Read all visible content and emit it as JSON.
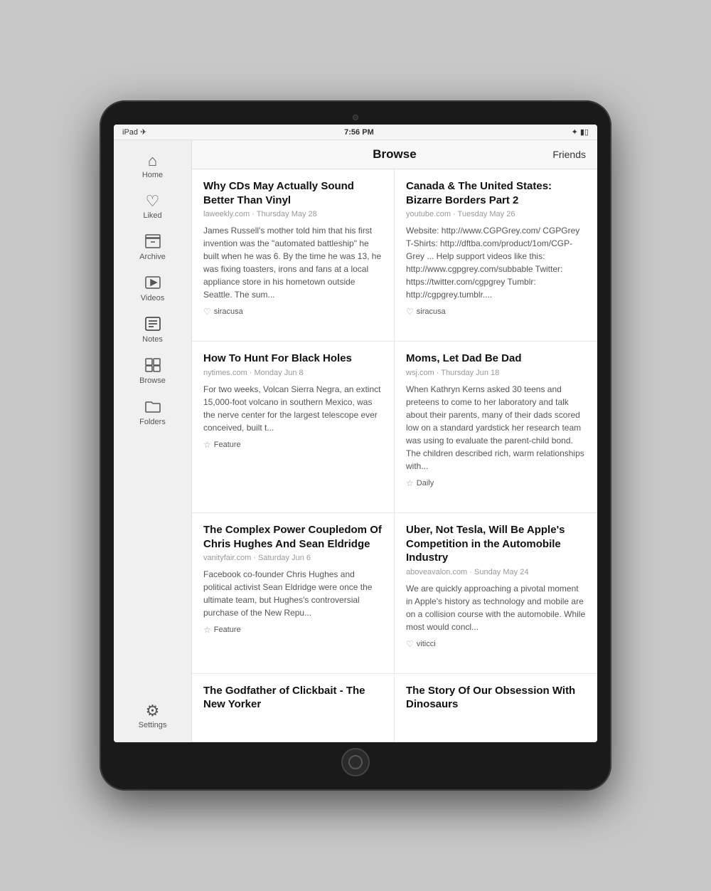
{
  "device": {
    "status_bar": {
      "left": "iPad ✈",
      "center": "7:56 PM",
      "right": "🔵 ■□"
    }
  },
  "sidebar": {
    "items": [
      {
        "id": "home",
        "label": "Home",
        "icon": "⌂"
      },
      {
        "id": "liked",
        "label": "Liked",
        "icon": "♡"
      },
      {
        "id": "archive",
        "label": "Archive",
        "icon": "▣"
      },
      {
        "id": "videos",
        "label": "Videos",
        "icon": "▷"
      },
      {
        "id": "notes",
        "label": "Notes",
        "icon": "≡"
      },
      {
        "id": "browse",
        "label": "Browse",
        "icon": "⊞"
      },
      {
        "id": "folders",
        "label": "Folders",
        "icon": "⬜"
      },
      {
        "id": "settings",
        "label": "Settings",
        "icon": "⚙"
      }
    ]
  },
  "top_bar": {
    "title": "Browse",
    "action": "Friends"
  },
  "articles": [
    {
      "id": 1,
      "title": "Why CDs May Actually Sound Better Than Vinyl",
      "meta": "laweekly.com · Thursday May 28",
      "excerpt": "James Russell's mother told him that his first invention was the \"automated battleship\" he built when he was 6. By the time he was 13, he was fixing toasters, irons and fans at a local appliance store in his hometown outside Seattle. The sum...",
      "footer_icon": "heart",
      "footer_tag": "siracusa"
    },
    {
      "id": 2,
      "title": "Canada & The United States: Bizarre Borders Part 2",
      "meta": "youtube.com · Tuesday May 26",
      "excerpt": "Website: http://www.CGPGrey.com/ CGPGrey T-Shirts: http://dftba.com/product/1om/CGP-Grey ... Help support videos like this: http://www.cgpgrey.com/subbable Twitter: https://twitter.com/cgpgrey Tumblr: http://cgpgrey.tumblr....",
      "footer_icon": "heart",
      "footer_tag": "siracusa"
    },
    {
      "id": 3,
      "title": "How To Hunt For Black Holes",
      "meta": "nytimes.com · Monday Jun 8",
      "excerpt": "For two weeks, Volcan Sierra Negra, an extinct 15,000-foot volcano in southern Mexico, was the nerve center for the largest telescope ever conceived, built t...",
      "footer_icon": "star",
      "footer_tag": "Feature"
    },
    {
      "id": 4,
      "title": "Moms, Let Dad Be Dad",
      "meta": "wsj.com · Thursday Jun 18",
      "excerpt": "When Kathryn Kerns asked 30 teens and preteens to come to her laboratory and talk about their parents, many of their dads scored low on a standard yardstick her research team was using to evaluate the parent-child bond. The children described rich, warm relationships with...",
      "footer_icon": "star",
      "footer_tag": "Daily"
    },
    {
      "id": 5,
      "title": "The Complex Power Coupledom Of Chris Hughes And Sean Eldridge",
      "meta": "vanityfair.com · Saturday Jun 6",
      "excerpt": "Facebook co-founder Chris Hughes and political activist Sean Eldridge were once the ultimate team, but Hughes's controversial purchase of the New Repu...",
      "footer_icon": "star",
      "footer_tag": "Feature"
    },
    {
      "id": 6,
      "title": "Uber, Not Tesla, Will Be Apple's Competition in the Automobile Industry",
      "meta": "aboveavalon.com · Sunday May 24",
      "excerpt": "We are quickly approaching a pivotal moment in Apple's history as technology and mobile are on a collision course with the automobile. While most would concl...",
      "footer_icon": "heart",
      "footer_tag": "viticci"
    },
    {
      "id": 7,
      "title": "The Godfather of Clickbait - The New Yorker",
      "meta": "",
      "excerpt": "",
      "footer_icon": "",
      "footer_tag": ""
    },
    {
      "id": 8,
      "title": "The Story Of Our Obsession With Dinosaurs",
      "meta": "",
      "excerpt": "",
      "footer_icon": "",
      "footer_tag": ""
    }
  ]
}
